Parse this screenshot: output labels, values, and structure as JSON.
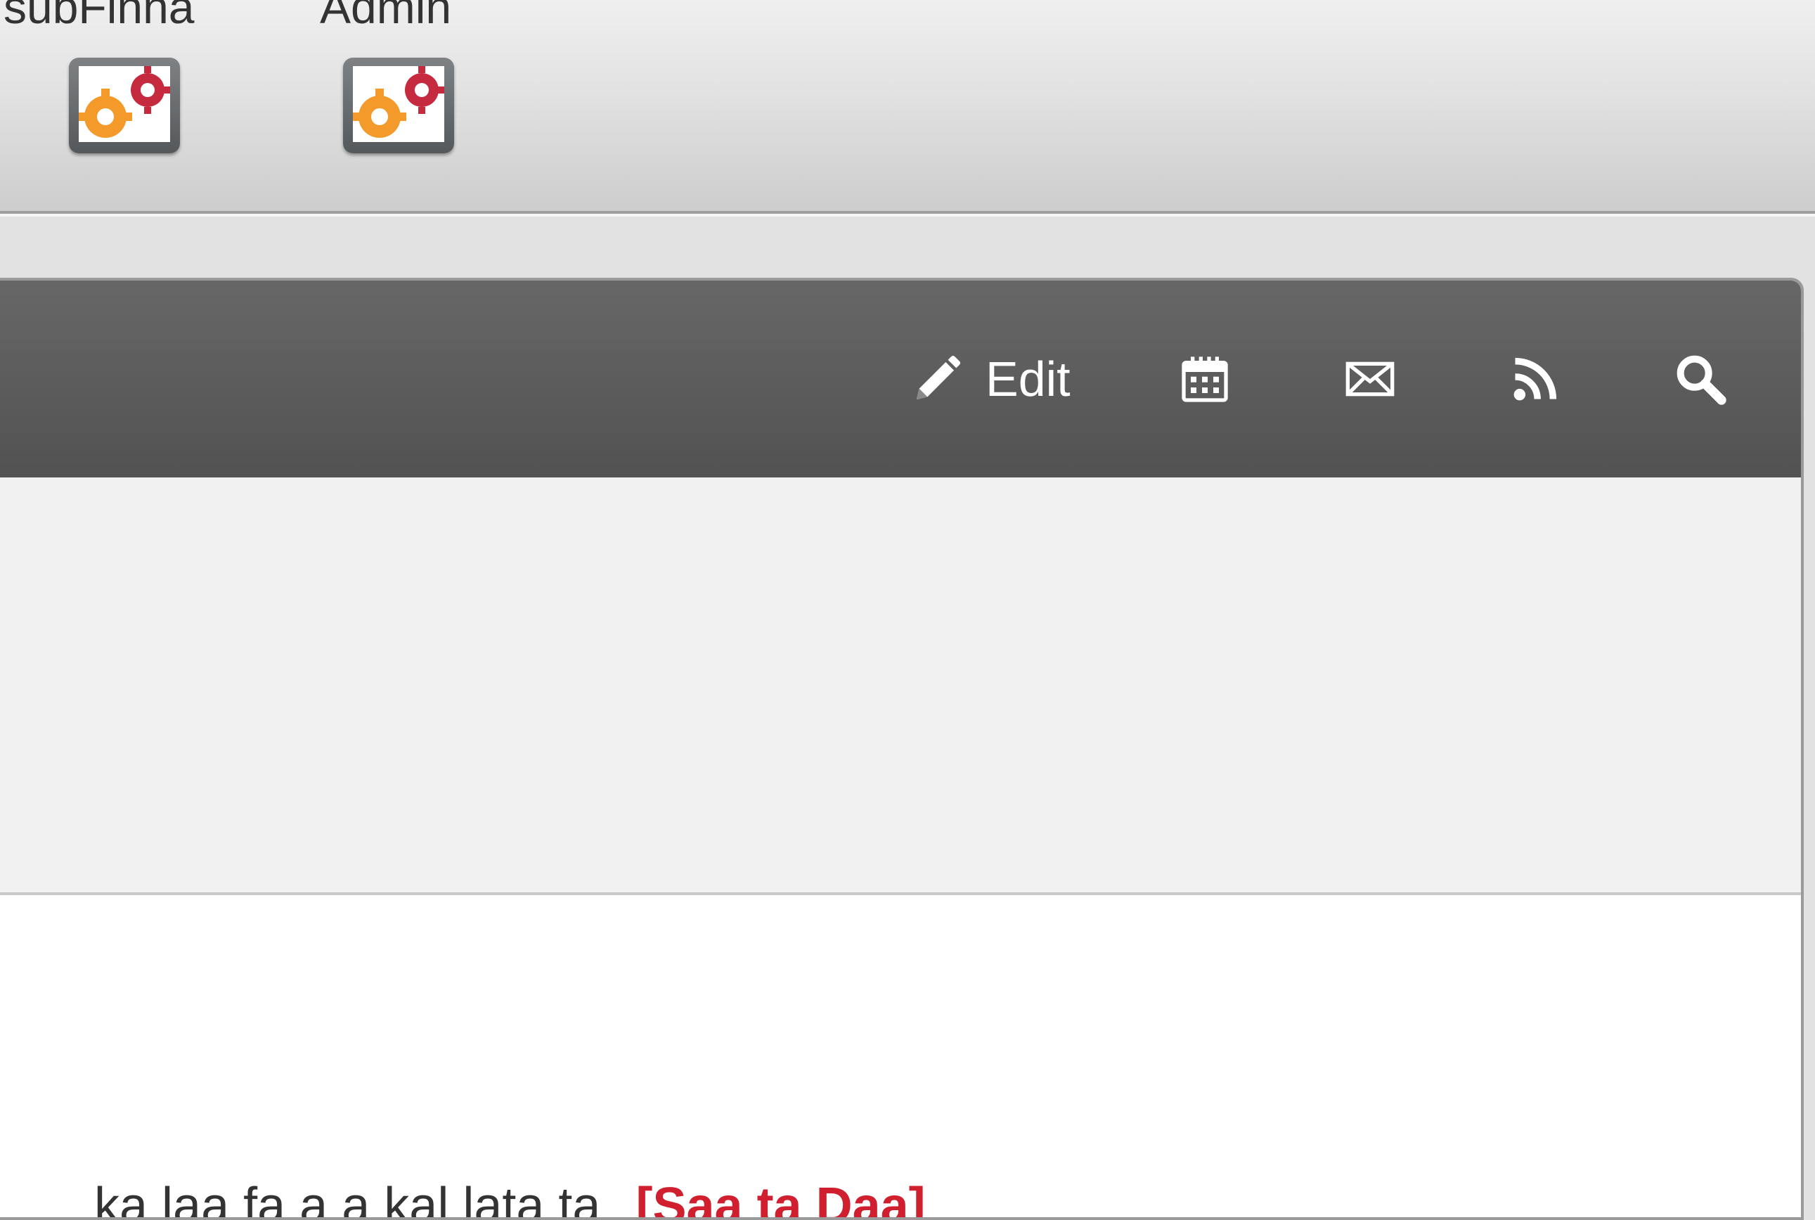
{
  "apps": [
    {
      "label": "subFinna"
    },
    {
      "label": "Admin"
    }
  ],
  "toolbar": {
    "edit_label": "Edit",
    "icons": [
      "pencil-icon",
      "calendar-icon",
      "mail-icon",
      "rss-icon",
      "search-icon"
    ]
  },
  "content": {
    "text": "ka laa fa  a  a kal  lata ta",
    "link": "[Saa ta Daa]"
  },
  "colors": {
    "toolbar": "#5a5a5a",
    "link": "#d0202f",
    "gear_orange": "#f39a2b",
    "gear_red": "#c52a3f"
  }
}
